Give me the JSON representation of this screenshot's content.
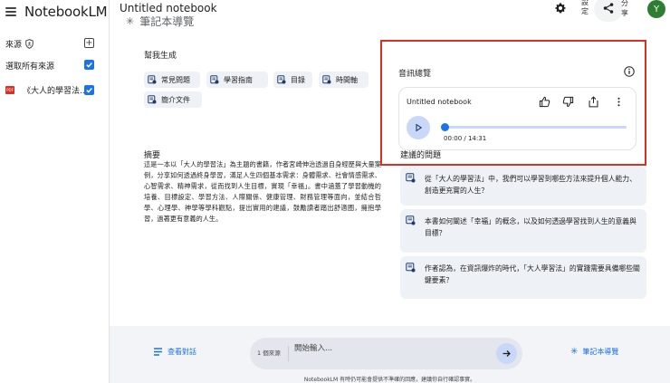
{
  "app": {
    "name": "NotebookLM"
  },
  "sidebar": {
    "sources_label": "來源",
    "select_all_label": "選取所有來源",
    "source_item": "《大人的學習法...",
    "pdf_badge": "PDF"
  },
  "topbar": {
    "notebook_title": "Untitled notebook",
    "settings_label": "設\n定",
    "share_label": "分\n享",
    "avatar_initial": "Y"
  },
  "guide": {
    "header": "筆記本導覽",
    "help_label": "幫我生成",
    "chips": [
      "常見問題",
      "學習指南",
      "目錄",
      "時間軸",
      "簡介文件"
    ],
    "summary_title": "摘要",
    "summary_text": "這是一本以「大人的學習法」為主題的書籍，作者宮崎伸治透過自身經歷與大量案例，分享如何透過終身學習，滿足人生四個基本需求：身體需求、社會情感需求、心智需求、精神需求，從而找到人生目標，實現「幸福」。書中涵蓋了學習動機的培養、目標設定、學習方法、人際關係、健康管理、財務管理等面向，並結合哲學、心理學、神學等學科觀點，提出實用的建議，鼓勵讀者踏出舒適圈，擁抱學習，過著更有意義的人生。"
  },
  "audio": {
    "title": "音訊總覽",
    "card_title": "Untitled notebook",
    "time": "00:00 / 14:31",
    "progress": 0
  },
  "questions": {
    "title": "建議的問題",
    "items": [
      "從「大人的學習法」中，我們可以學習到哪些方法來提升個人能力、創造更充實的人生？",
      "本書如何闡述「幸福」的概念，以及如何透過學習找到人生的意義與目標？",
      "作者認為，在資訊爆炸的時代，「大人學習法」的實踐需要具備哪些關鍵要素？"
    ]
  },
  "bottom": {
    "view_chat": "查看對話",
    "source_count": "1 個來源",
    "input_placeholder": "開始輸入...",
    "notebook_guide": "筆記本導覽",
    "disclaimer": "NotebookLM 有時仍可能會提供不準確的回應，建議你自行確認事實。"
  },
  "colors": {
    "accent": "#1a73e8",
    "highlight_box": "#d93025",
    "chip_bg": "#eef1f6"
  }
}
